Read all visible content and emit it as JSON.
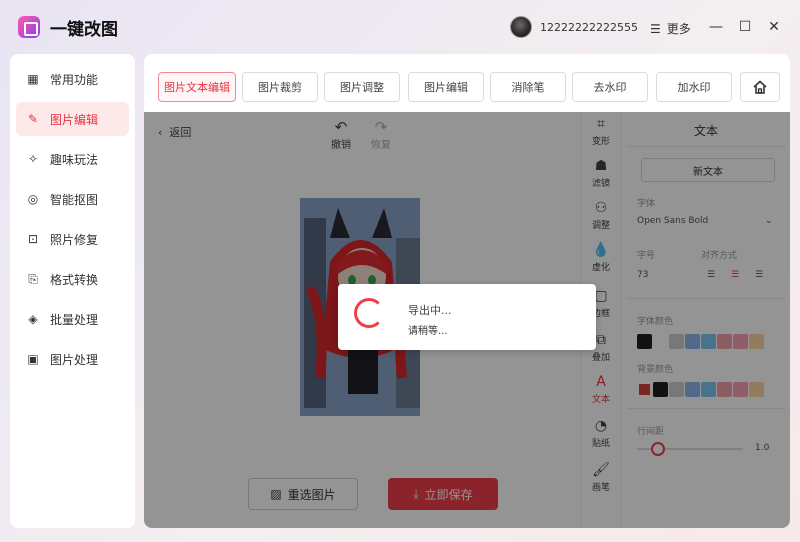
{
  "app": {
    "title": "一键改图",
    "phone": "12222222222555",
    "more_label": "更多"
  },
  "window_controls": {
    "minimize": "—",
    "maximize": "☐",
    "close": "✕"
  },
  "sidebar": {
    "items": [
      {
        "label": "常用功能",
        "icon": "grid-icon"
      },
      {
        "label": "图片编辑",
        "icon": "edit-icon"
      },
      {
        "label": "趣味玩法",
        "icon": "magic-icon"
      },
      {
        "label": "智能抠图",
        "icon": "target-icon"
      },
      {
        "label": "照片修复",
        "icon": "repair-icon"
      },
      {
        "label": "格式转换",
        "icon": "convert-icon"
      },
      {
        "label": "批量处理",
        "icon": "layers-icon"
      },
      {
        "label": "图片处理",
        "icon": "image-icon"
      }
    ],
    "active_index": 1
  },
  "tabs": [
    "图片文本编辑",
    "图片裁剪",
    "图片调整",
    "图片编辑",
    "消除笔",
    "去水印",
    "加水印"
  ],
  "workspace": {
    "back": "返回",
    "undo": "撤销",
    "redo": "恢复"
  },
  "buttons": {
    "reselect": "重选图片",
    "save": "立即保存"
  },
  "rail": [
    "变形",
    "滤镜",
    "调整",
    "虚化",
    "边框",
    "叠加",
    "文本",
    "贴纸",
    "画笔"
  ],
  "panel": {
    "title": "文本",
    "new_text": "新文本",
    "font_label": "字体",
    "font_value": "Open Sans Bold",
    "size_label": "字号",
    "size_value": "73",
    "align_label": "对齐方式",
    "font_color_label": "字体颜色",
    "bg_color_label": "背景颜色",
    "line_height_label": "行间距",
    "line_height_value": "1.0",
    "colors": [
      "#1f1f1f",
      "#cfcfcf",
      "#8fb4f0",
      "#7fc6f0",
      "#f1a0a8",
      "#f7a2b4",
      "#f9d7a0"
    ]
  },
  "dialog": {
    "title": "导出中...",
    "subtitle": "请稍等..."
  }
}
